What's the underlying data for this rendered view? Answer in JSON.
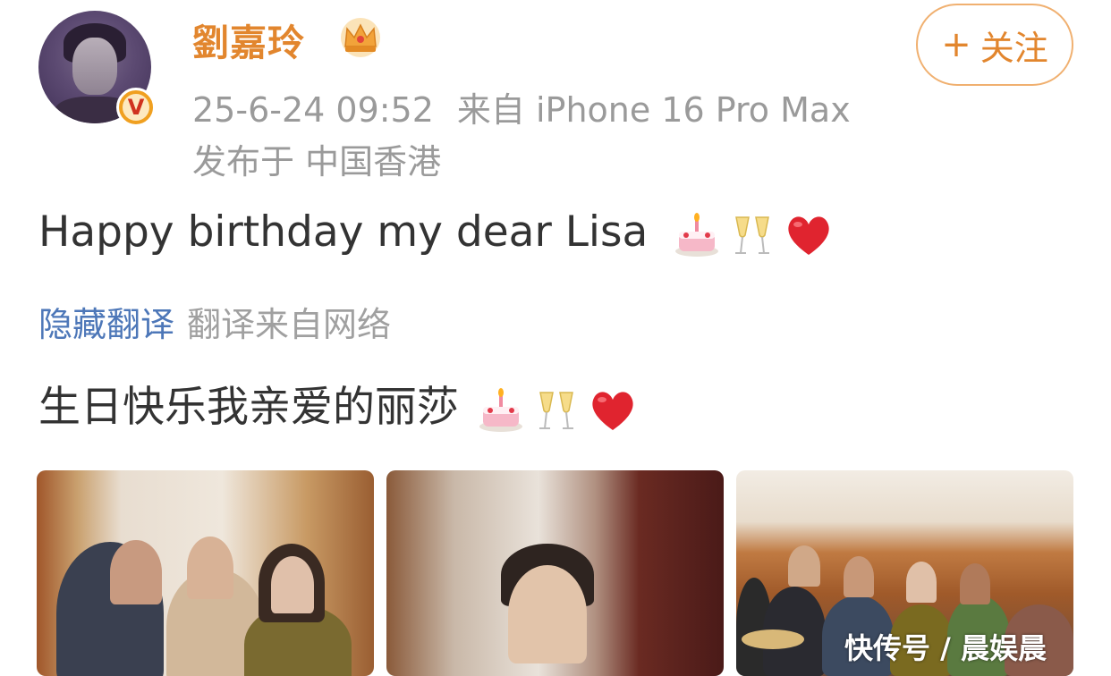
{
  "user": {
    "name": "劉嘉玲",
    "avatar_icon": "avatar-portrait",
    "verified_icon": "verified-v-icon",
    "verified_mark": "V",
    "vip_icon": "crown-icon"
  },
  "meta": {
    "time": "25-6-24 09:52",
    "source": "来自 iPhone 16 Pro Max",
    "location": "发布于 中国香港"
  },
  "follow_button": {
    "plus": "+",
    "label": "关注"
  },
  "post": {
    "text": "Happy birthday my dear Lisa",
    "emojis": [
      "cake-icon",
      "champagne-icon",
      "heart-icon"
    ]
  },
  "translation": {
    "hide_label": "隐藏翻译",
    "source_label": "翻译来自网络",
    "text": "生日快乐我亲爱的丽莎"
  },
  "photos": [
    "photo-1",
    "photo-2",
    "photo-3"
  ],
  "watermark": "快传号 / 晨娱晨",
  "colors": {
    "accent": "#e2862e",
    "link": "#4d77b8",
    "meta": "#9a9a9a",
    "text": "#333333"
  }
}
